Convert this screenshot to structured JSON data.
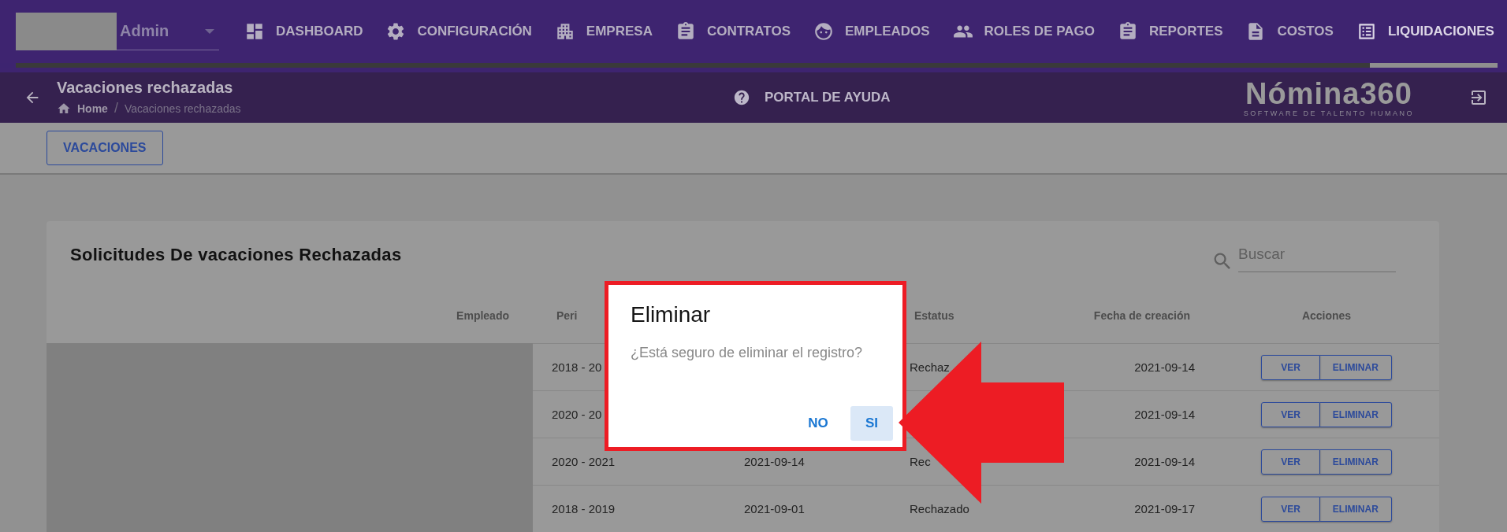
{
  "header": {
    "user": {
      "name": "Admin"
    },
    "nav": [
      {
        "label": "DASHBOARD",
        "selected": false
      },
      {
        "label": "CONFIGURACIÓN",
        "selected": false
      },
      {
        "label": "EMPRESA",
        "selected": false
      },
      {
        "label": "CONTRATOS",
        "selected": false
      },
      {
        "label": "EMPLEADOS",
        "selected": false
      },
      {
        "label": "ROLES DE PAGO",
        "selected": false
      },
      {
        "label": "REPORTES",
        "selected": false
      },
      {
        "label": "COSTOS",
        "selected": false
      },
      {
        "label": "LIQUIDACIONES",
        "selected": true
      }
    ]
  },
  "subheader": {
    "title": "Vacaciones rechazadas",
    "breadcrumb": [
      "Home",
      "Vacaciones rechazadas"
    ],
    "breadcrumb_separator": "/",
    "help": "PORTAL DE AYUDA",
    "logo": {
      "name": "Nómina360",
      "tagline": "SOFTWARE DE TALENTO HUMANO"
    }
  },
  "toolbar": {
    "button": "VACACIONES"
  },
  "card": {
    "title": "Solicitudes De vacaciones Rechazadas",
    "search": {
      "placeholder": "Buscar"
    },
    "table": {
      "columns": [
        "Empleado",
        "Peri",
        "",
        "Estatus",
        "Fecha de creación",
        "Acciones"
      ],
      "rows": [
        {
          "periodo": "2018 - 20",
          "estatus": "Rechaz",
          "fecha": "2021-09-14",
          "actions": [
            "VER",
            "ELIMINAR"
          ]
        },
        {
          "periodo": "2020 - 20",
          "fecha": "2021-09-14",
          "actions": [
            "VER",
            "ELIMINAR"
          ]
        },
        {
          "periodo": "2020 - 2021",
          "column_3": "2021-09-14",
          "estatus": "Rec",
          "fecha": "2021-09-14",
          "actions": [
            "VER",
            "ELIMINAR"
          ]
        },
        {
          "periodo": "2018 - 2019",
          "column_3": "2021-09-01",
          "estatus": "Rechazado",
          "fecha": "2021-09-17",
          "actions": [
            "VER",
            "ELIMINAR"
          ]
        }
      ]
    }
  },
  "dialog": {
    "title": "Eliminar",
    "message": "¿Está seguro de eliminar el registro?",
    "buttons": [
      {
        "label": "NO",
        "selected": false
      },
      {
        "label": "SI",
        "selected": true
      }
    ]
  }
}
